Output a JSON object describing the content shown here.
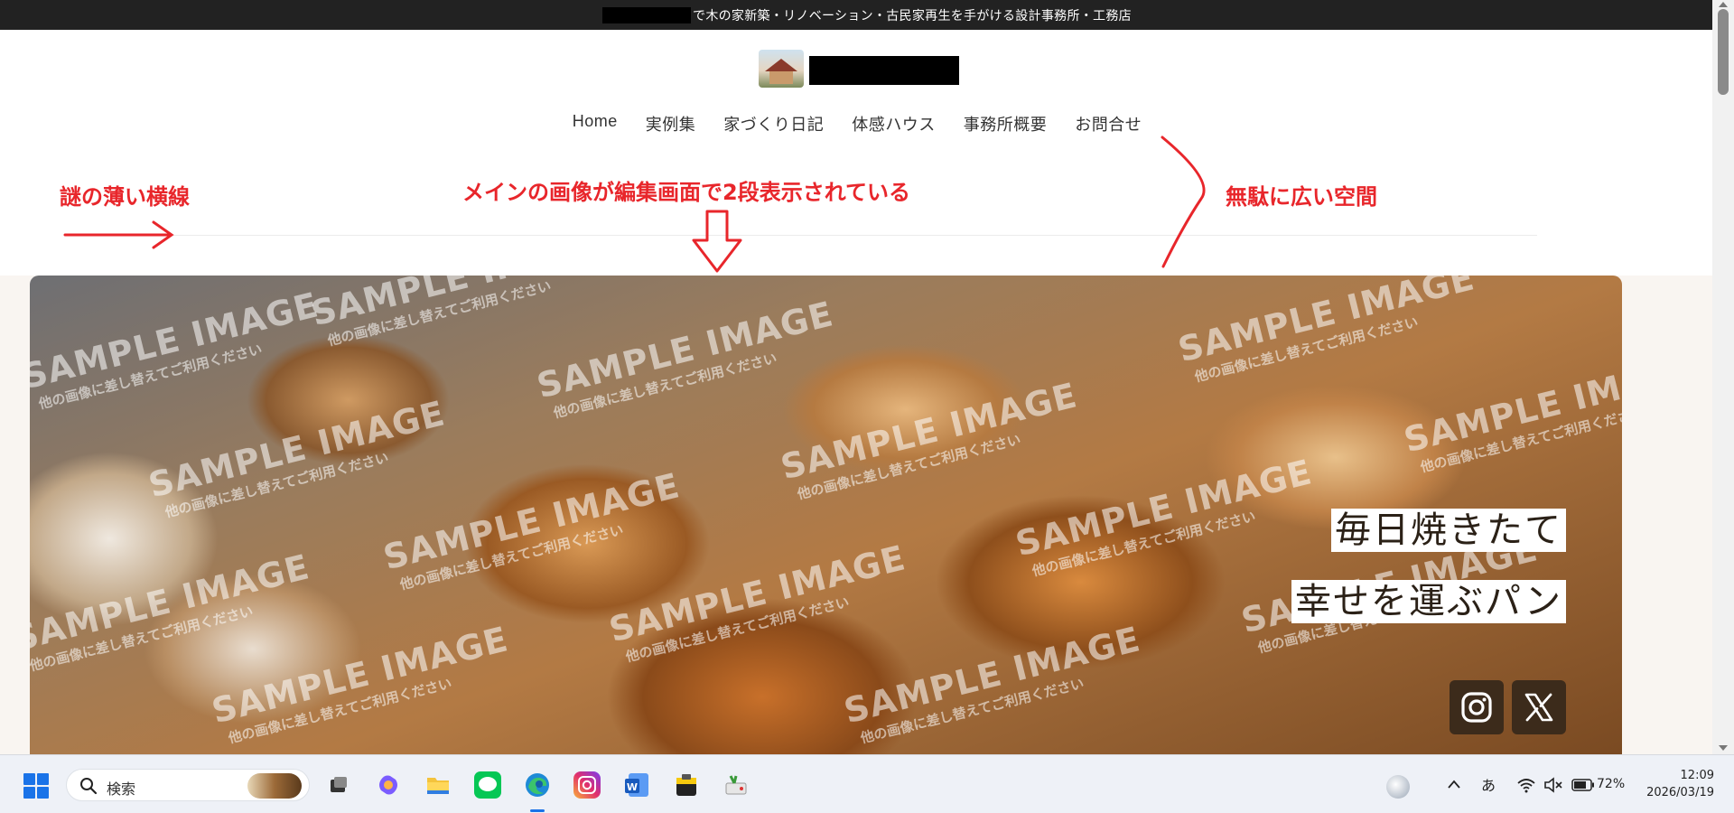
{
  "topbar": {
    "text": "で木の家新築・リノベーション・古民家再生を手がける設計事務所・工務店"
  },
  "nav": {
    "items": [
      "Home",
      "実例集",
      "家づくり日記",
      "体感ハウス",
      "事務所概要",
      "お問合せ"
    ]
  },
  "annotations": {
    "line_label": "謎の薄い横線",
    "double_label": "メインの画像が編集画面で2段表示されている",
    "space_label": "無駄に広い空間",
    "color": "#e8262b"
  },
  "hero": {
    "watermark_big": "SAMPLE IMAGE",
    "watermark_small": "他の画像に差し替えてご利用ください",
    "catch_line1": "毎日焼きたて",
    "catch_line2": "幸せを運ぶパン",
    "social_icons": [
      "instagram-icon",
      "x-icon"
    ]
  },
  "taskbar": {
    "search_label": "検索",
    "apps": [
      "task-view-icon",
      "copilot-icon",
      "file-explorer-icon",
      "line-icon",
      "edge-icon",
      "instagram-icon",
      "word-icon",
      "app-icon",
      "app-icon-2"
    ],
    "ime": "あ",
    "battery": "72%",
    "time": "12:09",
    "date": "2026/03/19"
  },
  "colors": {
    "topbar": "#222222",
    "social_button": "#3c2b1b",
    "hero_background": "#f9f5f1"
  }
}
